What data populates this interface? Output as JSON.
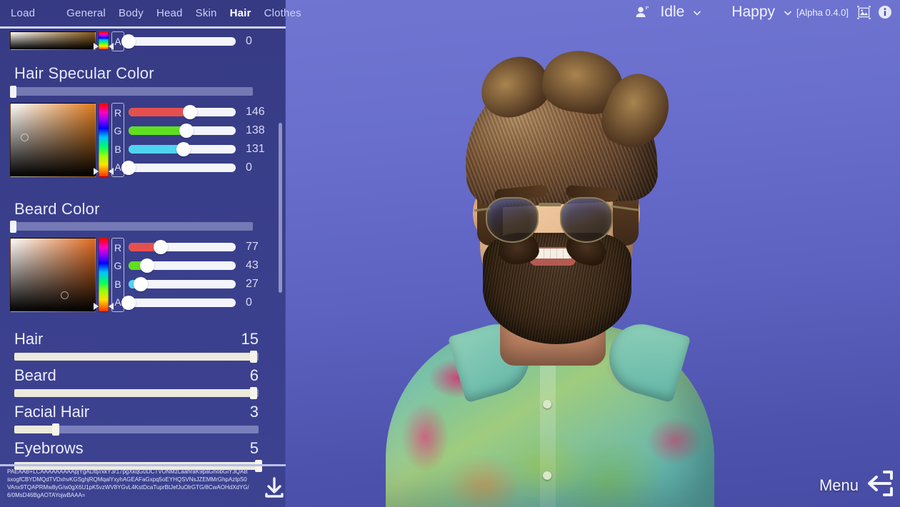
{
  "app": {
    "version_label": "[Alpha 0.4.0]",
    "background_top": "#7176d2",
    "background_bottom": "#474ca5",
    "panel_bg": "#323780"
  },
  "tabs": {
    "items": [
      {
        "label": "Load",
        "active": false,
        "name": "tab-load"
      },
      {
        "label": "General",
        "active": false,
        "name": "tab-general"
      },
      {
        "label": "Body",
        "active": false,
        "name": "tab-body"
      },
      {
        "label": "Head",
        "active": false,
        "name": "tab-head"
      },
      {
        "label": "Skin",
        "active": false,
        "name": "tab-skin"
      },
      {
        "label": "Hair",
        "active": true,
        "name": "tab-hair"
      },
      {
        "label": "Clothes",
        "active": false,
        "name": "tab-clothes"
      }
    ]
  },
  "topbar": {
    "character_icon": "person-add-icon",
    "animation": {
      "label": "Idle",
      "chevron": "chevron-down-icon"
    },
    "expression": {
      "label": "Happy",
      "chevron": "chevron-down-icon"
    },
    "version": "[Alpha 0.4.0]",
    "screenshot_icon": "image-frame-icon",
    "info_icon": "info-circle-icon"
  },
  "partial_color_picker_top": {
    "channels": [
      {
        "letter": "A",
        "value": "0",
        "fill_pct": 0,
        "color": "#ffffff"
      }
    ],
    "swatch_gradient": "black-to-brown"
  },
  "hair_specular_color": {
    "title": "Hair Specular Color",
    "value_bar_pct": 2,
    "hue_color": "#e07c20",
    "channels": [
      {
        "letter": "R",
        "value": "146",
        "fill_pct": 57,
        "color": "#e5504f"
      },
      {
        "letter": "G",
        "value": "138",
        "fill_pct": 54,
        "color": "#5fe01f"
      },
      {
        "letter": "B",
        "value": "131",
        "fill_pct": 51,
        "color": "#4fd4f0"
      },
      {
        "letter": "A",
        "value": "0",
        "fill_pct": 0,
        "color": "#ffffff"
      }
    ]
  },
  "beard_color": {
    "title": "Beard Color",
    "value_bar_pct": 2,
    "hue_color": "#e06a20",
    "channels": [
      {
        "letter": "R",
        "value": "77",
        "fill_pct": 30,
        "color": "#e5504f"
      },
      {
        "letter": "G",
        "value": "43",
        "fill_pct": 17,
        "color": "#5fe01f"
      },
      {
        "letter": "B",
        "value": "27",
        "fill_pct": 11,
        "color": "#4fd4f0"
      },
      {
        "letter": "A",
        "value": "0",
        "fill_pct": 0,
        "color": "#ffffff"
      }
    ]
  },
  "sliders": [
    {
      "label": "Hair",
      "value": "15",
      "fill_pct": 98,
      "name": "slider-hair"
    },
    {
      "label": "Beard",
      "value": "6",
      "fill_pct": 98,
      "name": "slider-beard"
    },
    {
      "label": "Facial Hair",
      "value": "3",
      "fill_pct": 17,
      "name": "slider-facial-hair"
    },
    {
      "label": "Eyebrows",
      "value": "5",
      "fill_pct": 100,
      "name": "slider-eyebrows"
    }
  ],
  "export": {
    "base64": "PAEAAB+LCAAAAAAAAApjYgADttj//xkY3r17pgXkqG0DCTVUNMzLaahraK9paGhobGiY3QABsxogfCBYDMQdTVDxhvKGSghjRQMqalYxyhAGEAFaGxpq5oEYHQSVNsJZEMMrGhpAzIpS0VAnx9TQAPRMw8yG/w0gX6U1pK5vzWV8YGvL4KstDcaTuprBtJefJuOlrGTG/8CwAOHdXdYG/6/0MsD46BgAOTAYojwBAAA=",
    "download_icon": "download-icon"
  },
  "menu": {
    "label": "Menu",
    "icon": "arrow-left-exit-icon"
  }
}
